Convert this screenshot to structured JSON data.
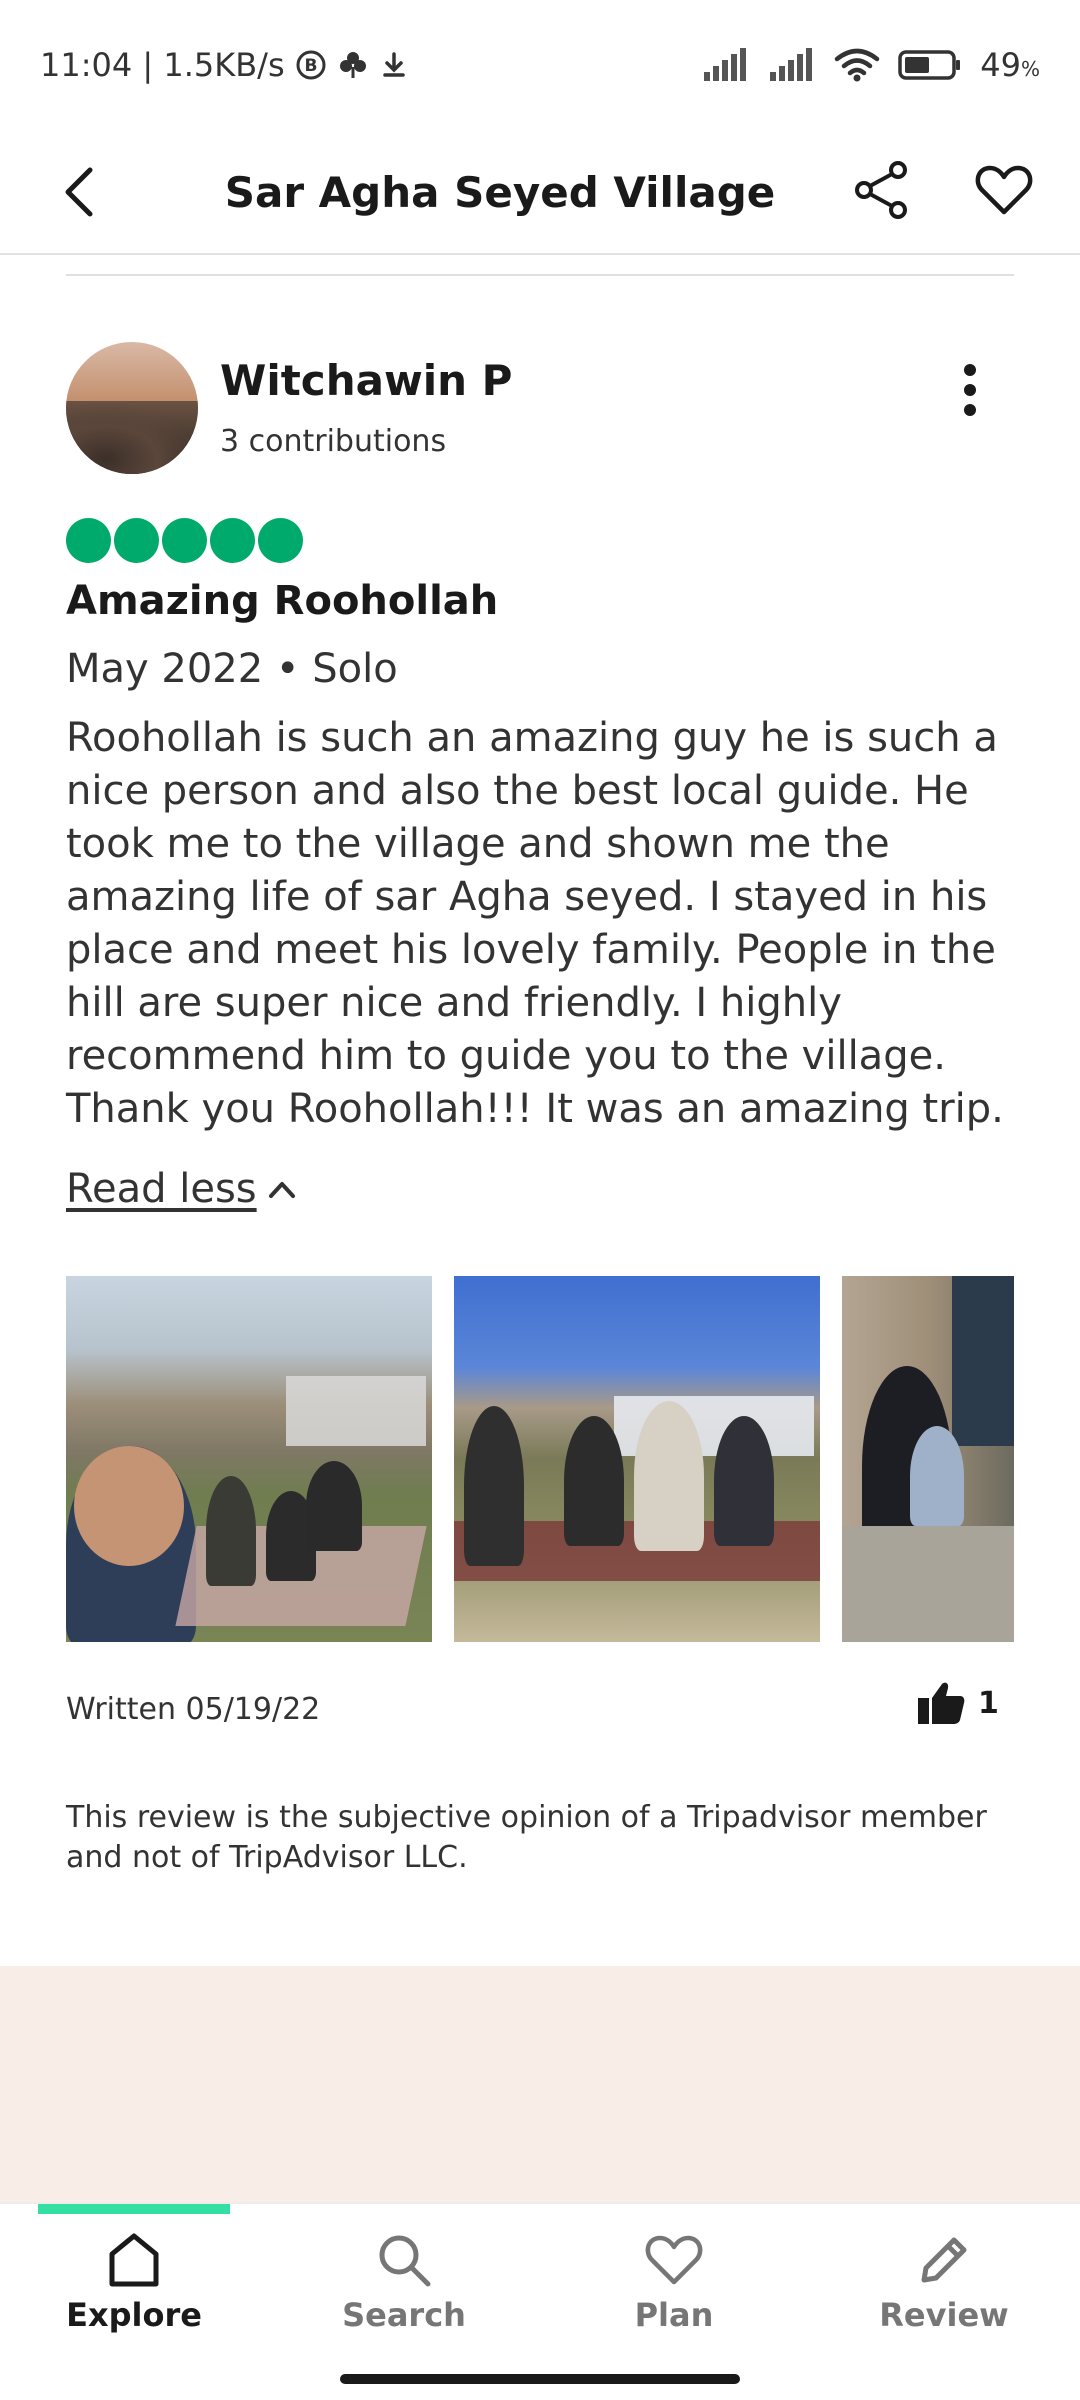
{
  "status_bar": {
    "time_speed": "11:04 | 1.5KB/s",
    "battery": "49"
  },
  "header": {
    "title": "Sar Agha Seyed Village"
  },
  "review": {
    "reviewer_name": "Witchawin P",
    "contributions": "3 contributions",
    "rating": 5,
    "title": "Amazing Roohollah",
    "meta": "May 2022 • Solo",
    "body": "Roohollah is such an amazing guy he is such a nice person and also the best local guide. He took me to the village and shown me the amazing life of sar Agha seyed. I stayed in his place and meet his lovely family. People in the hill are super nice and friendly. I highly recommend him to guide you to the village. Thank you Roohollah!!! It was an amazing trip.",
    "read_less": "Read less",
    "written": "Written 05/19/22",
    "likes": "1",
    "disclaimer": "This review is the subjective opinion of a Tripadvisor member and not of TripAdvisor LLC."
  },
  "nav": {
    "explore": "Explore",
    "search": "Search",
    "plan": "Plan",
    "review": "Review"
  },
  "colors": {
    "rating": "#00aa6c",
    "nav_indicator": "#34e0a1",
    "footer_bg": "#f9ede8"
  }
}
